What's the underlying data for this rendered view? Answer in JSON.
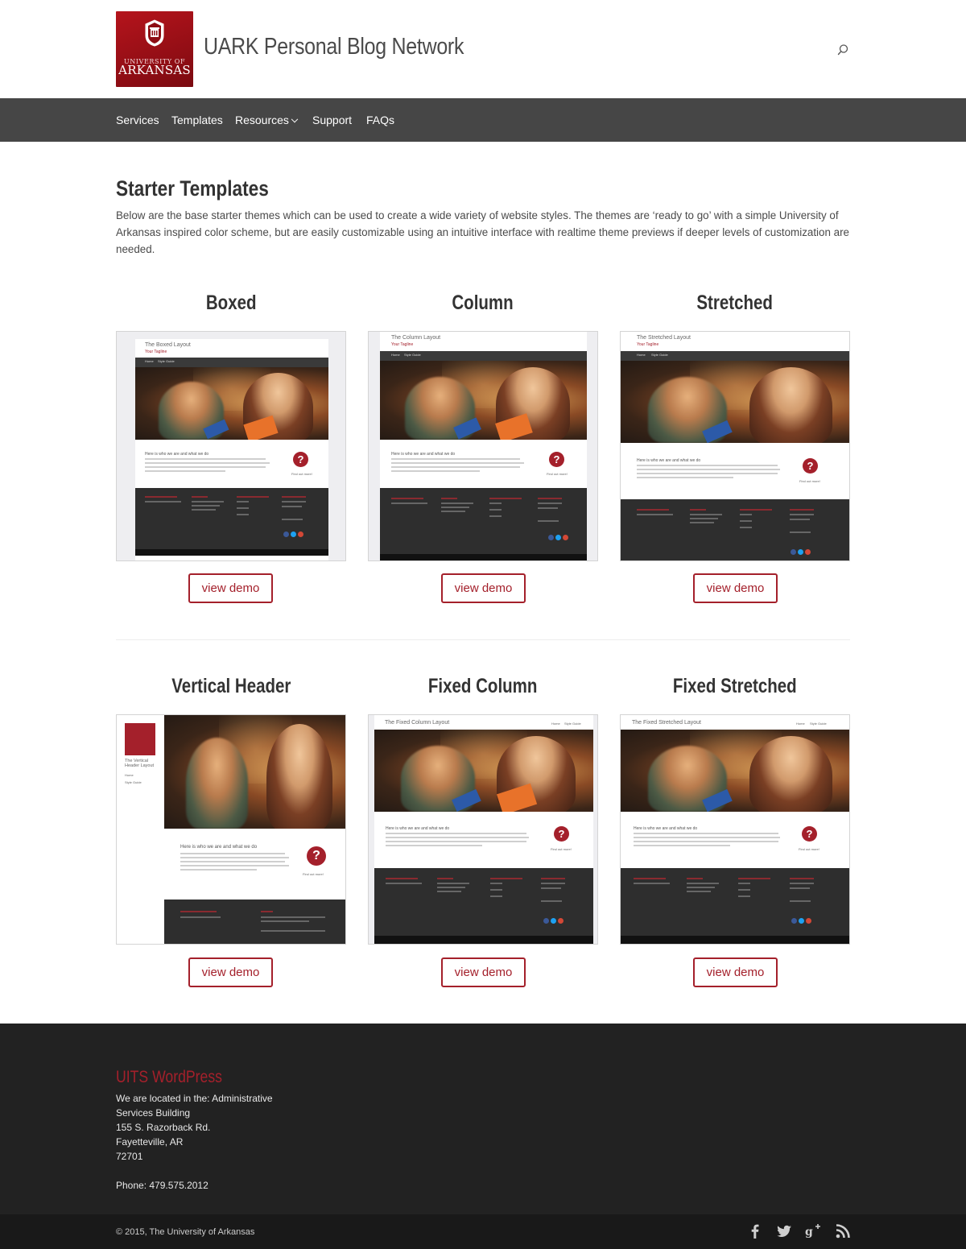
{
  "header": {
    "logo": {
      "line1": "UNIVERSITY OF",
      "line2": "ARKANSAS"
    },
    "site_title": "UARK Personal Blog Network",
    "search_icon": "search-icon"
  },
  "nav": {
    "items": [
      {
        "label": "Services"
      },
      {
        "label": "Templates"
      },
      {
        "label": "Resources",
        "has_dropdown": true
      },
      {
        "label": "Support"
      },
      {
        "label": "FAQs"
      }
    ]
  },
  "main": {
    "title": "Starter Templates",
    "intro": "Below are the base starter themes which can be used to create a wide variety of website styles. The themes are ‘ready to go’ with a simple University of Arkansas inspired color scheme, but are easily customizable using an intuitive interface with realtime theme previews if deeper levels of customization are needed.",
    "demo_label": "view demo",
    "templates": [
      {
        "name": "Boxed",
        "layout_title": "The Boxed Layout",
        "tagline": "Your Tagline"
      },
      {
        "name": "Column",
        "layout_title": "The Column Layout",
        "tagline": "Your Tagline"
      },
      {
        "name": "Stretched",
        "layout_title": "The Stretched Layout",
        "tagline": "Your Tagline"
      },
      {
        "name": "Vertical Header",
        "layout_title": "The Vertical Header Layout",
        "tagline": ""
      },
      {
        "name": "Fixed Column",
        "layout_title": "The Fixed Column Layout",
        "tagline": ""
      },
      {
        "name": "Fixed Stretched",
        "layout_title": "The Fixed Stretched Layout",
        "tagline": ""
      }
    ],
    "mock": {
      "heading": "Here is who we are and what we do",
      "find_out": "Find out more!",
      "nav_home": "Home",
      "nav_style": "Style Guide"
    }
  },
  "footer": {
    "title": "UITS WordPress",
    "address_lines": [
      "We are located in the: Administrative",
      "Services Building",
      "155 S. Razorback Rd.",
      "Fayetteville, AR",
      "72701"
    ],
    "phone": "Phone: 479.575.2012",
    "copyright": "© 2015, The University of Arkansas",
    "social": [
      "facebook-icon",
      "twitter-icon",
      "google-plus-icon",
      "rss-icon"
    ]
  },
  "colors": {
    "accent": "#a4202b",
    "nav_bg": "#464646",
    "footer_bg": "#222222",
    "bottom_bar": "#191919"
  }
}
